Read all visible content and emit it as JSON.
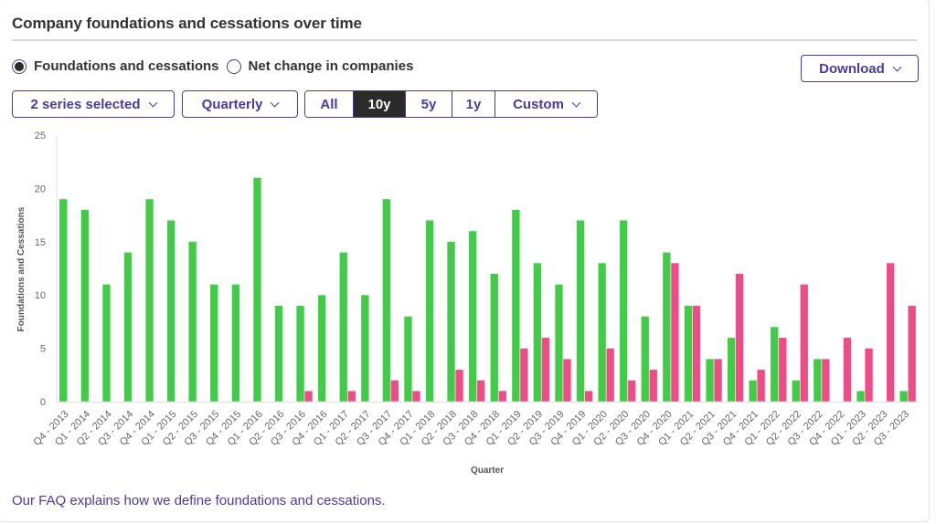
{
  "header": {
    "title": "Company foundations and cessations over time"
  },
  "view_mode": {
    "options": [
      {
        "label": "Foundations and cessations",
        "checked": true
      },
      {
        "label": "Net change in companies",
        "checked": false
      }
    ]
  },
  "controls": {
    "series_dropdown": "2 series selected",
    "interval_dropdown": "Quarterly",
    "download_label": "Download",
    "ranges": [
      {
        "label": "All",
        "active": false
      },
      {
        "label": "10y",
        "active": true
      },
      {
        "label": "5y",
        "active": false
      },
      {
        "label": "1y",
        "active": false
      },
      {
        "label": "Custom",
        "active": false,
        "dropdown": true
      }
    ]
  },
  "footer": {
    "faq_text": "Our FAQ explains how we define foundations and cessations."
  },
  "colors": {
    "foundations": "#41cc47",
    "cessations": "#ef4b86",
    "accent": "#4a3aa0"
  },
  "chart_data": {
    "type": "bar",
    "title": "",
    "xlabel": "Quarter",
    "ylabel": "Foundations and Cessations",
    "ylim": [
      0,
      25
    ],
    "yticks": [
      0,
      5,
      10,
      15,
      20,
      25
    ],
    "grid": false,
    "categories": [
      "Q4 - 2013",
      "Q1 - 2014",
      "Q2 - 2014",
      "Q3 - 2014",
      "Q4 - 2014",
      "Q1 - 2015",
      "Q2 - 2015",
      "Q3 - 2015",
      "Q4 - 2015",
      "Q1 - 2016",
      "Q2 - 2016",
      "Q3 - 2016",
      "Q4 - 2016",
      "Q1 - 2017",
      "Q2 - 2017",
      "Q3 - 2017",
      "Q4 - 2017",
      "Q1 - 2018",
      "Q2 - 2018",
      "Q3 - 2018",
      "Q4 - 2018",
      "Q1 - 2019",
      "Q2 - 2019",
      "Q3 - 2019",
      "Q4 - 2019",
      "Q1 - 2020",
      "Q2 - 2020",
      "Q3 - 2020",
      "Q4 - 2020",
      "Q1 - 2021",
      "Q2 - 2021",
      "Q3 - 2021",
      "Q4 - 2021",
      "Q1 - 2022",
      "Q2 - 2022",
      "Q3 - 2022",
      "Q4 - 2022",
      "Q1 - 2023",
      "Q2 - 2023",
      "Q3 - 2023"
    ],
    "series": [
      {
        "name": "Foundations",
        "color": "#41cc47",
        "values": [
          19,
          18,
          11,
          14,
          19,
          17,
          15,
          11,
          11,
          21,
          9,
          9,
          10,
          14,
          10,
          19,
          8,
          17,
          15,
          16,
          12,
          18,
          13,
          11,
          17,
          13,
          17,
          8,
          14,
          9,
          4,
          6,
          2,
          7,
          2,
          4,
          0,
          1,
          0,
          1
        ]
      },
      {
        "name": "Cessations",
        "color": "#ef4b86",
        "values": [
          0,
          0,
          0,
          0,
          0,
          0,
          0,
          0,
          0,
          0,
          0,
          1,
          0,
          1,
          0,
          2,
          1,
          0,
          3,
          2,
          1,
          5,
          6,
          4,
          1,
          5,
          2,
          3,
          13,
          9,
          4,
          12,
          3,
          6,
          11,
          4,
          6,
          5,
          13,
          9
        ]
      }
    ]
  }
}
